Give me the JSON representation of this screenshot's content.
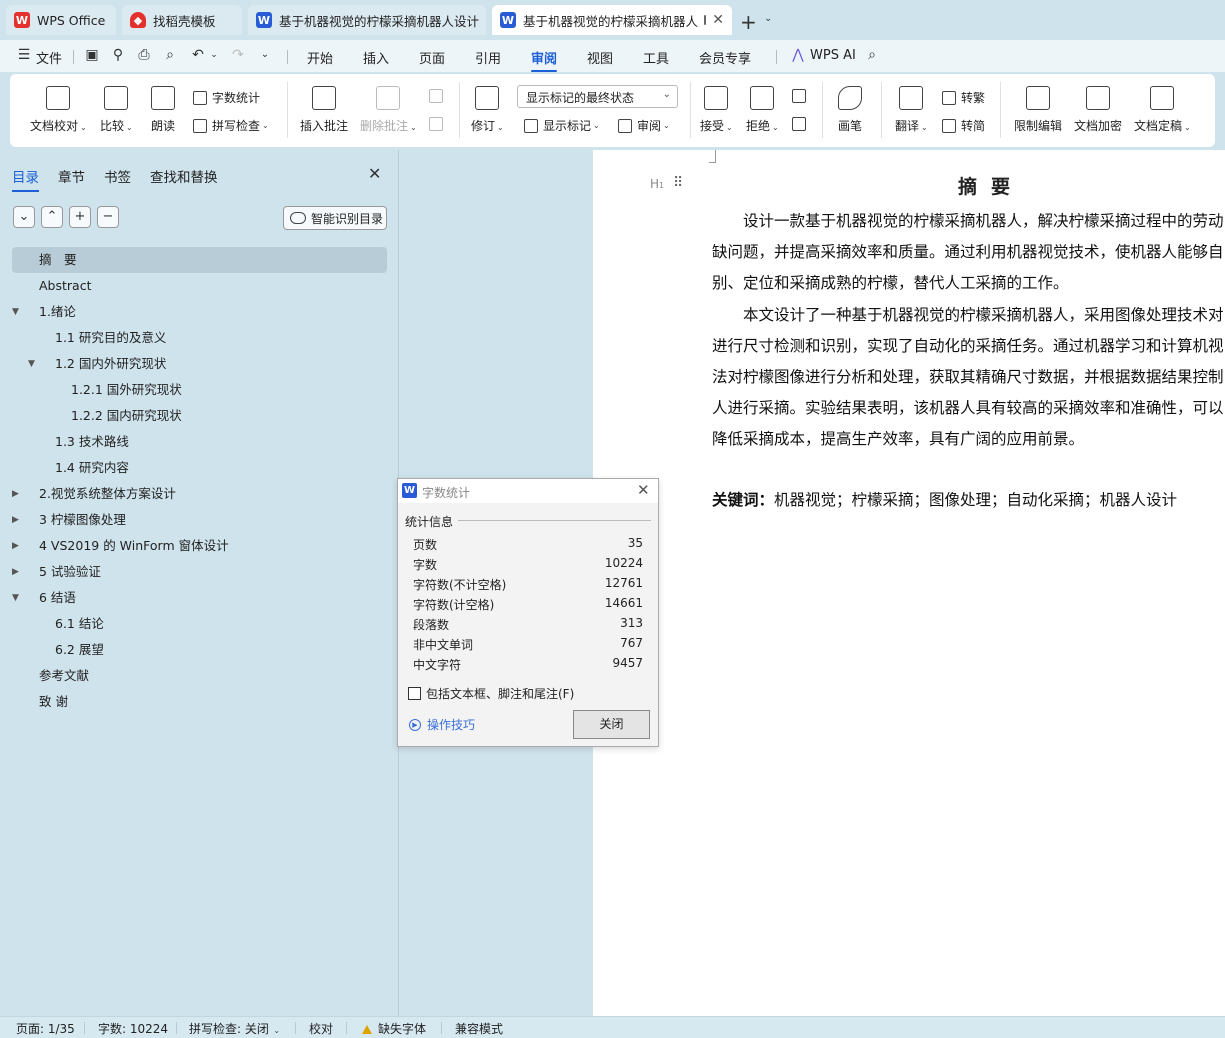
{
  "tabs": [
    {
      "label": "WPS Office",
      "icon": "wps-logo-icon"
    },
    {
      "label": "找稻壳模板",
      "icon": "docer-icon"
    },
    {
      "label": "基于机器视觉的柠檬采摘机器人设计",
      "icon": "writer-doc-icon"
    },
    {
      "label": "基于机器视觉的柠檬采摘机器人",
      "icon": "writer-doc-icon"
    }
  ],
  "menu": {
    "file": "文件",
    "items": [
      "开始",
      "插入",
      "页面",
      "引用",
      "审阅",
      "视图",
      "工具",
      "会员专享"
    ],
    "active": "审阅",
    "wps_ai": "WPS AI"
  },
  "ribbon": {
    "doc_check": "文档校对",
    "compare": "比较",
    "read_aloud": "朗读",
    "word_count": "字数统计",
    "spell_check": "拼写检查",
    "insert_comment": "插入批注",
    "delete_comment": "删除批注",
    "track_changes": "修订",
    "markup_state": "显示标记的最终状态",
    "show_markup": "显示标记",
    "review": "审阅",
    "accept": "接受",
    "reject": "拒绝",
    "pen": "画笔",
    "translate": "翻译",
    "to_traditional": "转繁",
    "to_simplified": "转简",
    "restrict_edit": "限制编辑",
    "encrypt": "文档加密",
    "finalize": "文档定稿"
  },
  "nav": {
    "tabs": [
      "目录",
      "章节",
      "书签",
      "查找和替换"
    ],
    "smart_toc": "智能识别目录",
    "toc": [
      {
        "label": "摘　要",
        "level": 0,
        "arrow": "",
        "selected": true
      },
      {
        "label": "Abstract",
        "level": 0,
        "arrow": ""
      },
      {
        "label": "1.绪论",
        "level": 0,
        "arrow": "down"
      },
      {
        "label": "1.1 研究目的及意义",
        "level": 1,
        "arrow": ""
      },
      {
        "label": "1.2 国内外研究现状",
        "level": 1,
        "arrow": "down"
      },
      {
        "label": "1.2.1 国外研究现状",
        "level": 2,
        "arrow": ""
      },
      {
        "label": "1.2.2 国内研究现状",
        "level": 2,
        "arrow": ""
      },
      {
        "label": "1.3  技术路线",
        "level": 1,
        "arrow": ""
      },
      {
        "label": "1.4  研究内容",
        "level": 1,
        "arrow": ""
      },
      {
        "label": "2.视觉系统整体方案设计",
        "level": 0,
        "arrow": "right"
      },
      {
        "label": "3  柠檬图像处理",
        "level": 0,
        "arrow": "right"
      },
      {
        "label": "4 VS2019 的 WinForm 窗体设计",
        "level": 0,
        "arrow": "right"
      },
      {
        "label": "5  试验验证",
        "level": 0,
        "arrow": "right"
      },
      {
        "label": "6  结语",
        "level": 0,
        "arrow": "down"
      },
      {
        "label": "6.1  结论",
        "level": 1,
        "arrow": ""
      },
      {
        "label": "6.2  展望",
        "level": 1,
        "arrow": ""
      },
      {
        "label": "参考文献",
        "level": 0,
        "arrow": ""
      },
      {
        "label": "致  谢",
        "level": 0,
        "arrow": ""
      }
    ]
  },
  "document": {
    "title": "摘要",
    "lines": [
      "　　设计一款基于机器视觉的柠檬采摘机器人，解决柠檬采摘过程中的劳动",
      "缺问题，并提高采摘效率和质量。通过利用机器视觉技术，使机器人能够自",
      "别、定位和采摘成熟的柠檬，替代人工采摘的工作。",
      "　　本文设计了一种基于机器视觉的柠檬采摘机器人，采用图像处理技术对",
      "进行尺寸检测和识别，实现了自动化的采摘任务。通过机器学习和计算机视",
      "法对柠檬图像进行分析和处理，获取其精确尺寸数据，并根据数据结果控制",
      "人进行采摘。实验结果表明，该机器人具有较高的采摘效率和准确性，可以",
      "降低采摘成本，提高生产效率，具有广阔的应用前景。"
    ],
    "keywords_label": "关键词：",
    "keywords": "机器视觉；柠檬采摘；图像处理；自动化采摘；机器人设计"
  },
  "dialog": {
    "title": "字数统计",
    "group": "统计信息",
    "stats": [
      {
        "label": "页数",
        "value": "35"
      },
      {
        "label": "字数",
        "value": "10224"
      },
      {
        "label": "字符数(不计空格)",
        "value": "12761"
      },
      {
        "label": "字符数(计空格)",
        "value": "14661"
      },
      {
        "label": "段落数",
        "value": "313"
      },
      {
        "label": "非中文单词",
        "value": "767"
      },
      {
        "label": "中文字符",
        "value": "9457"
      }
    ],
    "checkbox_label": "包括文本框、脚注和尾注(F)",
    "checkbox_checked": false,
    "tips": "操作技巧",
    "close": "关闭"
  },
  "status": {
    "page": "页面: 1/35",
    "words": "字数: 10224",
    "spell": "拼写检查: 关闭",
    "proof": "校对",
    "missing_font": "缺失字体",
    "compat": "兼容模式"
  },
  "colors": {
    "accent": "#1d5fd6",
    "wps_red": "#e5312d",
    "writer_blue": "#2a5bd7"
  }
}
